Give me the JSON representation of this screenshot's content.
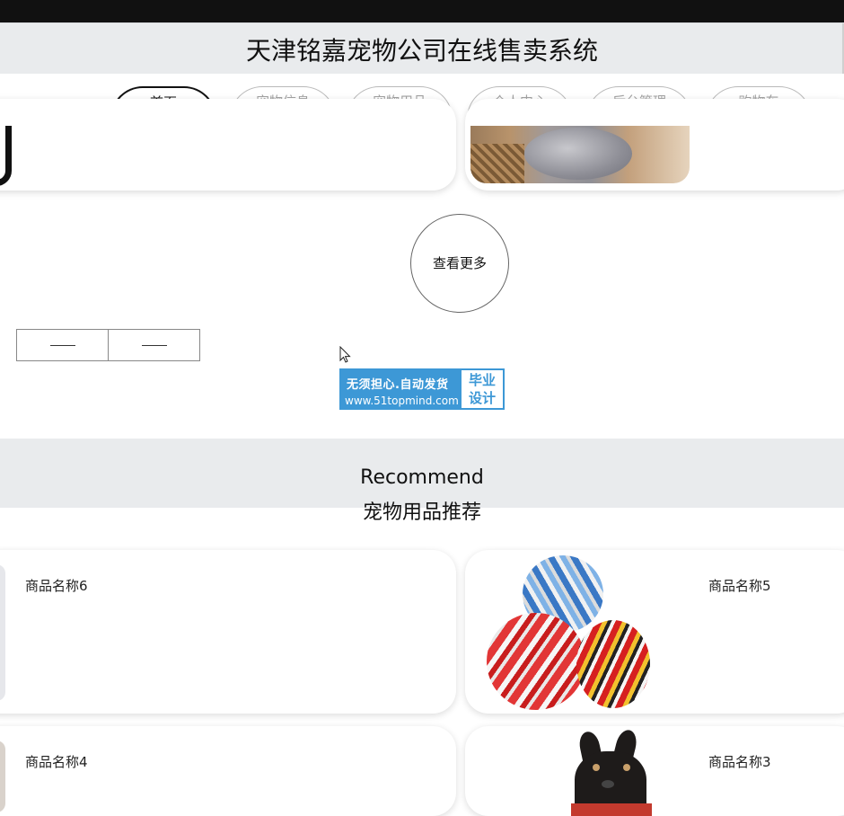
{
  "header": {
    "title": "天津铭嘉宠物公司在线售卖系统"
  },
  "nav": {
    "tabs": [
      {
        "label": "首页",
        "active": true
      },
      {
        "label": "宠物信息",
        "active": false
      },
      {
        "label": "宠物用品",
        "active": false
      },
      {
        "label": "个人中心",
        "active": false
      },
      {
        "label": "后台管理",
        "active": false
      },
      {
        "label": "购物车",
        "active": false
      }
    ]
  },
  "more_button": {
    "label": "查看更多"
  },
  "pager": {
    "prev_label": "",
    "next_label": ""
  },
  "badge": {
    "line1": "无须担心.自动发货",
    "line2": "www.51topmind.com",
    "right_line1": "毕业",
    "right_line2": "设计",
    "color": "#3d98d6"
  },
  "recommend": {
    "title_en": "Recommend",
    "title_cn": "宠物用品推荐",
    "products": [
      {
        "name": "商品名称6"
      },
      {
        "name": "商品名称5"
      },
      {
        "name": "商品名称4"
      },
      {
        "name": "商品名称3"
      }
    ]
  },
  "colors": {
    "topbar": "#111111",
    "header_bg": "#e9ebed",
    "tab_inactive_text": "#a3a3a3",
    "tab_active_border": "#111111"
  }
}
